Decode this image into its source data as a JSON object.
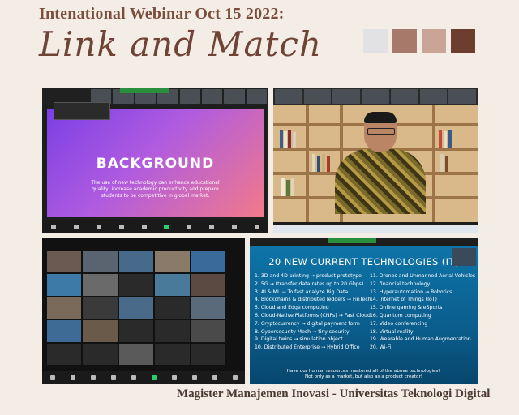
{
  "header": {
    "title": "Intenational Webinar Oct 15 2022:",
    "subtitle": "Link and Match"
  },
  "palette": [
    "#e2e2e4",
    "#a7796a",
    "#c9a598",
    "#6d3d2f"
  ],
  "footer": {
    "text": "Magister Manajemen Inovasi - Universitas Teknologi Digital"
  },
  "panel1": {
    "slide_title": "BACKGROUND",
    "slide_text": "The use of new technology can enhance educational quality, increase academic productivity and prepare students to be competitive in global market."
  },
  "panel4": {
    "slide_title": "20 NEW CURRENT TECHNOLOGIES (IT)",
    "left_items": [
      "1. 3D and 4D printing → product prototype",
      "2. 5G → (transfer data rates up to 20 Gbps)",
      "3. AI & ML → To fast analyze Big Data",
      "4. Blockchains & distributed ledgers → FinTech",
      "5. Cloud and Edge computing",
      "6. Cloud-Native Platforms (CNPs) → Fast Cloud",
      "7. Cryptocurrency → digital payment form",
      "8. Cybersecurity Mesh → tiny security",
      "9. Digital twins → simulation object",
      "10. Distributed Enterprise → Hybrid Office"
    ],
    "right_items": [
      "11. Drones and Unmanned Aerial Vehicles",
      "12. financial technology",
      "13. Hyperautomation → Robotics",
      "14. Internet of Things (IoT)",
      "15. Online gaming & eSports",
      "16. Quantum computing",
      "17. Video conferencing",
      "18. Virtual reality",
      "19. Wearable and Human Augmentation",
      "20. Wi-Fi"
    ],
    "question": "Have our human resources mastered all of the above technologies?",
    "question2": "Not only as a market, but also as a product creator!"
  }
}
